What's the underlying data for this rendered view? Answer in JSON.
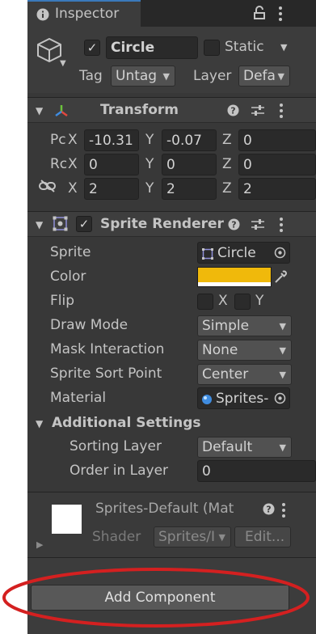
{
  "tab": {
    "title": "Inspector",
    "icon": "info-icon"
  },
  "gameobject": {
    "active": "✓",
    "name": "Circle",
    "static_label": "Static",
    "tag_label": "Tag",
    "tag_value": "Untag",
    "layer_label": "Layer",
    "layer_value": "Defa"
  },
  "transform": {
    "title": "Transform",
    "rows": [
      {
        "label": "Pc",
        "x": "-10.31",
        "y": "-0.07",
        "z": "0"
      },
      {
        "label": "Rc",
        "x": "0",
        "y": "0",
        "z": "0"
      },
      {
        "label": "",
        "x": "2",
        "y": "2",
        "z": "2"
      }
    ],
    "axis": {
      "x": "X",
      "y": "Y",
      "z": "Z"
    }
  },
  "sprite_renderer": {
    "enabled": "✓",
    "title": "Sprite Renderer",
    "sprite_label": "Sprite",
    "sprite_value": "Circle",
    "color_label": "Color",
    "color_value": "#f0b90b",
    "flip_label": "Flip",
    "flip_x": "X",
    "flip_y": "Y",
    "draw_mode_label": "Draw Mode",
    "draw_mode_value": "Simple",
    "mask_label": "Mask Interaction",
    "mask_value": "None",
    "sort_point_label": "Sprite Sort Point",
    "sort_point_value": "Center",
    "material_label": "Material",
    "material_value": "Sprites-",
    "additional_title": "Additional Settings",
    "sorting_layer_label": "Sorting Layer",
    "sorting_layer_value": "Default",
    "order_label": "Order in Layer",
    "order_value": "0"
  },
  "material_preview": {
    "name": "Sprites-Default (Mat",
    "shader_label": "Shader",
    "shader_value": "Sprites/I",
    "edit_label": "Edit..."
  },
  "add_component_label": "Add Component",
  "colors": {
    "panel_bg": "#383838",
    "header_bg": "#3e3e3e",
    "accent": "#3a79bb",
    "annotation": "#d42020"
  }
}
